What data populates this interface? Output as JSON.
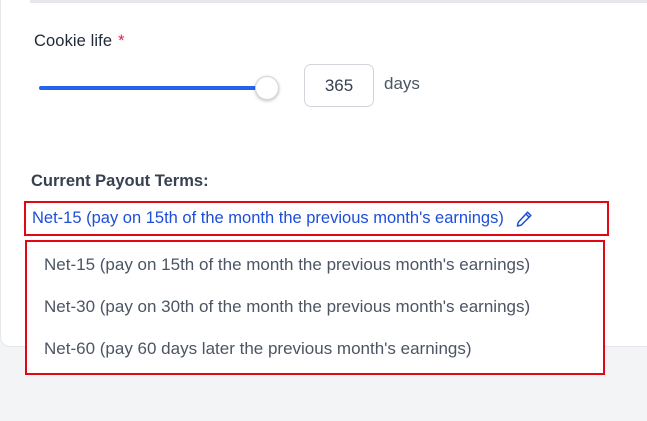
{
  "cookie": {
    "label": "Cookie life",
    "required_mark": "*",
    "value": "365",
    "unit": "days",
    "slider_level": 1.0
  },
  "payout": {
    "label": "Current Payout Terms:",
    "current": "Net-15 (pay on 15th of the month the previous month's earnings)",
    "options": [
      "Net-15 (pay on 15th of the month the previous month's earnings)",
      "Net-30 (pay on 30th of the month the previous month's earnings)",
      "Net-60 (pay 60 days later the previous month's earnings)"
    ]
  },
  "colors": {
    "accent": "#2563eb",
    "link": "#1d4ed8",
    "highlight_border": "#e30613",
    "required": "#e11d48"
  },
  "icons": {
    "edit": "pencil-icon"
  }
}
